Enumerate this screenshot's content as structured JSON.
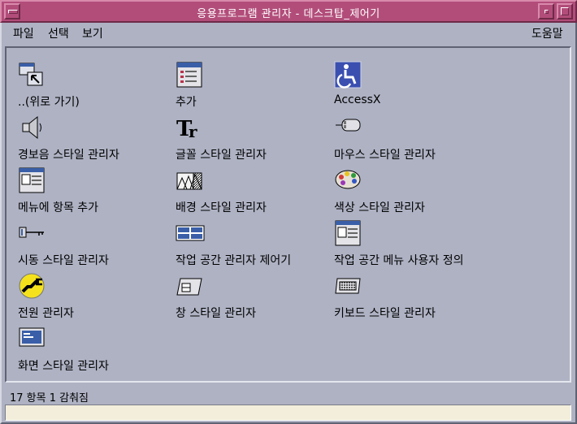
{
  "window": {
    "title": "응용프로그램 관리자 - 데스크탑_제어기"
  },
  "menubar": {
    "file": "파일",
    "select": "선택",
    "view": "보기",
    "help": "도움말"
  },
  "items": [
    {
      "label": "..(위로 가기)",
      "icon": "go-up-icon"
    },
    {
      "label": "추가",
      "icon": "add-icon"
    },
    {
      "label": "AccessX",
      "icon": "accessibility-icon"
    },
    {
      "label": "경보음 스타일 관리자",
      "icon": "speaker-icon"
    },
    {
      "label": "글꼴 스타일 관리자",
      "icon": "font-icon"
    },
    {
      "label": "마우스 스타일 관리자",
      "icon": "mouse-icon"
    },
    {
      "label": "메뉴에 항목 추가",
      "icon": "menu-add-icon"
    },
    {
      "label": "배경 스타일 관리자",
      "icon": "backdrop-icon"
    },
    {
      "label": "색상 스타일 관리자",
      "icon": "palette-icon"
    },
    {
      "label": "시동 스타일 관리자",
      "icon": "key-icon"
    },
    {
      "label": "작업 공간 관리자 제어기",
      "icon": "workspace-icon"
    },
    {
      "label": "작업 공간 메뉴 사용자 정의",
      "icon": "workspace-menu-icon"
    },
    {
      "label": "전원 관리자",
      "icon": "power-plug-icon"
    },
    {
      "label": "창 스타일 관리자",
      "icon": "window-icon"
    },
    {
      "label": "키보드 스타일 관리자",
      "icon": "keyboard-icon"
    },
    {
      "label": "화면 스타일 관리자",
      "icon": "screen-icon"
    }
  ],
  "status": {
    "text": "17 항목 1 감춰짐"
  },
  "colors": {
    "titlebar": "#b24d7a",
    "background": "#aeb2c3",
    "footer": "#f2eedb"
  }
}
